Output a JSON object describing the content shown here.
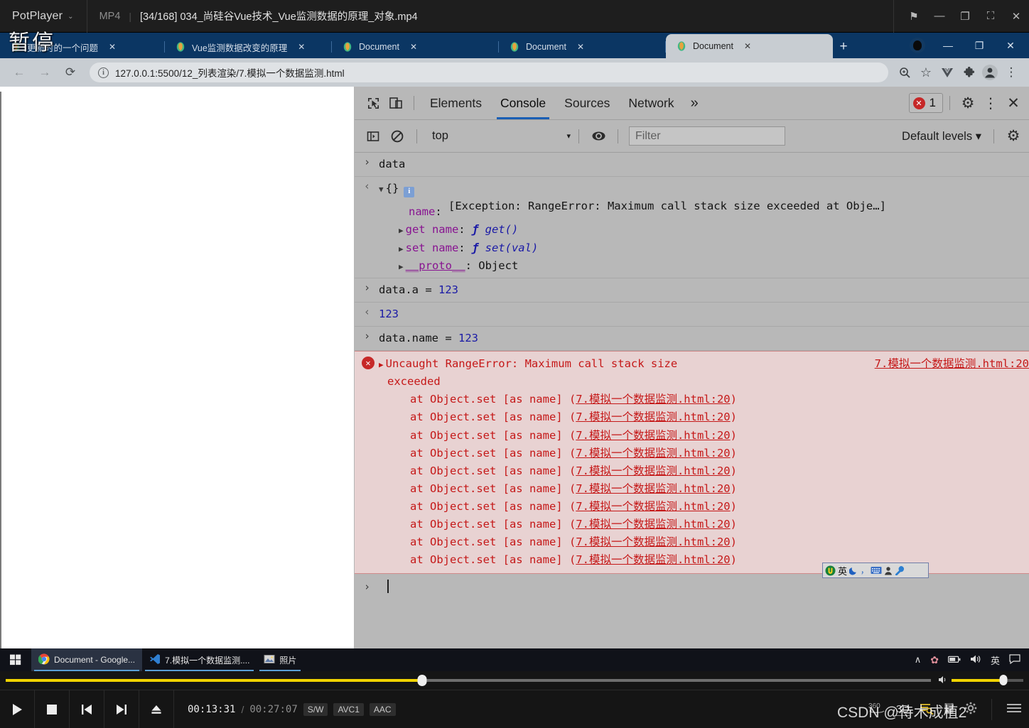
{
  "potplayer": {
    "app_name": "PotPlayer",
    "dropdown_caret": "⌄",
    "format": "MP4",
    "separator": "|",
    "title": "[34/168] 034_尚硅谷Vue技术_Vue监测数据的原理_对象.mp4",
    "window_buttons": [
      {
        "name": "pin-button",
        "glyph": "⚑"
      },
      {
        "name": "minimize-button",
        "glyph": "—"
      },
      {
        "name": "restore-button",
        "glyph": "❐"
      },
      {
        "name": "fullscreen-button",
        "glyph": "⛶"
      },
      {
        "name": "close-button",
        "glyph": "✕"
      }
    ],
    "overlay_status": "暂停",
    "controls": {
      "play": "▶",
      "stop": "■",
      "previous": "⏮",
      "next": "⏭",
      "eject": "⏏",
      "current_time": "00:13:31",
      "slash": "/",
      "total_time": "00:27:07",
      "chips": [
        "S/W",
        "AVC1",
        "AAC"
      ],
      "right_icons": [
        "360°",
        "3D",
        "playlist-icon",
        "bookmark-icon",
        "settings-icon",
        "menu-icon"
      ],
      "seek_percent": 45,
      "volume_percent": 72,
      "volume_icon": "🔊"
    },
    "watermark": "CSDN @待木成植2"
  },
  "browser": {
    "tabs": [
      {
        "label": "更新时的一个问题",
        "favicon": "vue-favicon",
        "active": false
      },
      {
        "label": "Vue监测数据改变的原理",
        "favicon": "vue-favicon",
        "active": false
      },
      {
        "label": "Document",
        "favicon": "vue-favicon",
        "active": false
      },
      {
        "label": "Document",
        "favicon": "vue-favicon",
        "active": false
      },
      {
        "label": "Document",
        "favicon": "vue-favicon",
        "active": true
      }
    ],
    "tab_close_glyph": "✕",
    "new_tab_glyph": "+",
    "window_buttons": [
      {
        "name": "minimize-button",
        "glyph": "—"
      },
      {
        "name": "maximize-button",
        "glyph": "❐"
      },
      {
        "name": "close-button",
        "glyph": "✕"
      }
    ],
    "nav": {
      "back": "←",
      "forward": "→",
      "reload": "⟳"
    },
    "url": "127.0.0.1:5500/12_列表渲染/7.模拟一个数据监测.html",
    "url_info_glyph": "i",
    "toolbar_icons": [
      {
        "name": "zoom-icon",
        "glyph": "⊕"
      },
      {
        "name": "bookmark-star-icon",
        "glyph": "☆"
      },
      {
        "name": "vue-devtools-icon",
        "glyph": "V"
      },
      {
        "name": "extensions-puzzle-icon",
        "glyph": "❈"
      },
      {
        "name": "profile-avatar-icon",
        "glyph": "●"
      },
      {
        "name": "chrome-menu-icon",
        "glyph": "⋮"
      }
    ]
  },
  "devtools": {
    "inspect_icon": "inspect-element-icon",
    "device_icon": "device-toolbar-icon",
    "tabs": [
      "Elements",
      "Console",
      "Sources",
      "Network"
    ],
    "active_tab": "Console",
    "more_tabs_glyph": "»",
    "error_count": "1",
    "error_badge_glyph": "✕",
    "settings_glyph": "⚙",
    "kebab_glyph": "⋮",
    "close_glyph": "✕",
    "toolbar": {
      "sidebar_toggle": "console-sidebar-icon",
      "clear_glyph": "⊘",
      "context": "top",
      "context_caret": "▾",
      "eye_glyph": "◉",
      "filter_placeholder": "Filter",
      "levels": "Default levels",
      "levels_caret": "▾",
      "settings_glyph": "⚙"
    },
    "console": {
      "prompt_glyph": "›",
      "result_glyph": "‹",
      "entries": [
        {
          "kind": "input",
          "text": "data"
        },
        {
          "kind": "object_result",
          "collapse_glyph": "▼",
          "brace": "{}",
          "info_glyph": "i",
          "props": [
            {
              "indent": 1,
              "key": "name",
              "sep": ": ",
              "value": "[Exception: RangeError: Maximum call stack size exceeded at Obje…]"
            },
            {
              "indent": 2,
              "tri": "▶",
              "key": "get name",
              "sep": ": ",
              "fkw": "ƒ",
              "value": " get()"
            },
            {
              "indent": 2,
              "tri": "▶",
              "key": "set name",
              "sep": ": ",
              "fkw": "ƒ",
              "value": " set(val)"
            },
            {
              "indent": 2,
              "tri": "▶",
              "key": "__proto__",
              "sep": ": ",
              "value": "Object"
            }
          ]
        },
        {
          "kind": "input",
          "code": "data.a = ",
          "num": "123"
        },
        {
          "kind": "result_num",
          "num": "123"
        },
        {
          "kind": "input",
          "code": "data.name = ",
          "num": "123"
        }
      ],
      "error": {
        "tri": "▶",
        "icon_glyph": "✕",
        "message_line1": "Uncaught RangeError: Maximum call stack size",
        "message_line2": "exceeded",
        "source_link": "7.模拟一个数据监测.html:20",
        "stack_prefix": "at Object.set [as name] (",
        "stack_link": "7.模拟一个数据监测.html:20",
        "stack_suffix": ")",
        "stack_repeat": 10
      }
    }
  },
  "ime": {
    "name": "sogou-ime-bar",
    "items": [
      {
        "name": "sogou-logo-icon",
        "glyph": "U"
      },
      {
        "name": "language-mode-label",
        "glyph": "英"
      },
      {
        "name": "moon-icon",
        "glyph": "☾"
      },
      {
        "name": "punctuation-icon",
        "glyph": "，"
      },
      {
        "name": "soft-keyboard-icon",
        "glyph": "⌨"
      },
      {
        "name": "user-icon",
        "glyph": "♟"
      },
      {
        "name": "toolbox-icon",
        "glyph": "⚒"
      }
    ]
  },
  "taskbar": {
    "start_glyph": "⊞",
    "items": [
      {
        "label": "Document - Google...",
        "icon": "chrome-icon",
        "active": true
      },
      {
        "label": "7.模拟一个数据监测....",
        "icon": "vscode-icon",
        "active": false
      },
      {
        "label": "照片",
        "icon": "photos-icon",
        "active": false
      }
    ],
    "tray": [
      {
        "name": "show-hidden-icons",
        "glyph": "∧"
      },
      {
        "name": "sakura-icon",
        "glyph": "✿"
      },
      {
        "name": "battery-icon",
        "glyph": "▣"
      },
      {
        "name": "volume-icon",
        "glyph": "🔊"
      },
      {
        "name": "ime-language-label",
        "glyph": "英"
      },
      {
        "name": "action-center-icon",
        "glyph": "▭"
      }
    ]
  },
  "colors": {
    "chrome_blue": "#0d3b66",
    "devtools_bg": "#b8b8b8",
    "error_red": "#c51818",
    "error_row_bg": "#e8d2d2",
    "accent_blue": "#1a5fb4",
    "potplayer_yellow": "#f2d400"
  }
}
